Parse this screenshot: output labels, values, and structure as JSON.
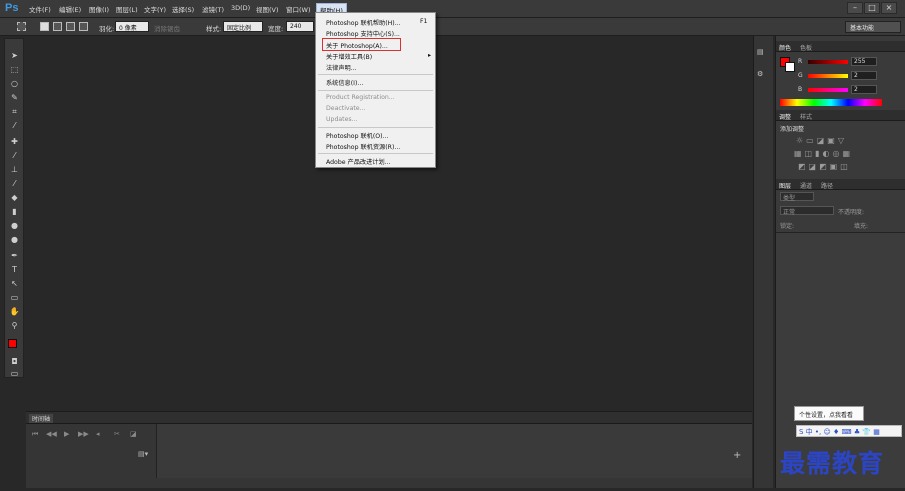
{
  "app": {
    "logo": "Ps"
  },
  "menubar": {
    "items": [
      "文件(F)",
      "编辑(E)",
      "图像(I)",
      "图层(L)",
      "文字(Y)",
      "选择(S)",
      "滤镜(T)",
      "3D(D)",
      "视图(V)",
      "窗口(W)",
      "帮助(H)"
    ],
    "active": "帮助(H)",
    "window_buttons": [
      "–",
      "□",
      "×"
    ]
  },
  "options_bar": {
    "feather_label": "羽化:",
    "feather_value": "0 像素",
    "antialias_label": "消除锯齿",
    "style_label": "样式:",
    "style_value": "固定比例",
    "width_label": "宽度:",
    "width_value": "240",
    "workspace": "基本功能"
  },
  "help_menu": {
    "items": [
      {
        "label": "Photoshop 联机帮助(H)...",
        "shortcut": "F1",
        "disabled": false
      },
      {
        "label": "Photoshop 支持中心(S)...",
        "shortcut": "",
        "disabled": false
      },
      {
        "label": "关于 Photoshop(A)...",
        "shortcut": "",
        "disabled": false
      },
      {
        "label": "关于增效工具(B)",
        "shortcut": "▸",
        "disabled": false
      },
      {
        "label": "法律声明...",
        "shortcut": "",
        "disabled": false
      },
      {
        "label": "系统信息(I)...",
        "shortcut": "",
        "disabled": false
      },
      {
        "label": "Product Registration...",
        "shortcut": "",
        "disabled": true
      },
      {
        "label": "Deactivate...",
        "shortcut": "",
        "disabled": true
      },
      {
        "label": "Updates...",
        "shortcut": "",
        "disabled": true
      },
      {
        "label": "Photoshop 联机(O)...",
        "shortcut": "",
        "disabled": false
      },
      {
        "label": "Photoshop 联机资源(R)...",
        "shortcut": "",
        "disabled": false
      },
      {
        "label": "Adobe 产品改进计划...",
        "shortcut": "",
        "disabled": false
      }
    ],
    "highlighted": "关于 Photoshop(A)..."
  },
  "timeline": {
    "tab_label": "时间轴"
  },
  "color_panel": {
    "tabs": [
      "颜色",
      "色板"
    ],
    "channels": [
      {
        "label": "R",
        "value": "255"
      },
      {
        "label": "G",
        "value": "2"
      },
      {
        "label": "B",
        "value": "2"
      }
    ],
    "foreground": "#ff0000",
    "background": "#ffffff"
  },
  "adjust_panel": {
    "tabs": [
      "调整",
      "样式"
    ],
    "title": "添加调整"
  },
  "layers_panel": {
    "tabs": [
      "图层",
      "通道",
      "路径"
    ],
    "kind": "类型",
    "blend": "正常",
    "opacity_label": "不透明度:",
    "lock_label": "锁定:",
    "fill_label": "填充:"
  },
  "tooltip": {
    "text": "个性设置，点我看看"
  },
  "ime_bar": {
    "text": "S 中 •, ☺ ♦ ⌨ ♣ 👕 ▦"
  },
  "watermark": {
    "text": "最需教育"
  },
  "colors": {
    "accent": "#3f9ae0",
    "highlight_box": "#d93030",
    "watermark": "#2b45c4"
  }
}
